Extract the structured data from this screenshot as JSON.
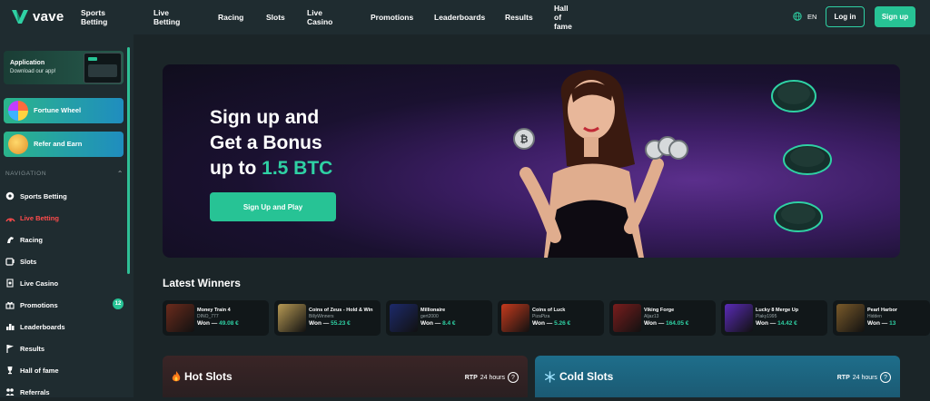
{
  "header": {
    "logo_text": "vave",
    "nav": [
      "Sports Betting",
      "Live Betting",
      "Racing",
      "Slots",
      "Live Casino",
      "Promotions",
      "Leaderboards",
      "Results",
      "Hall of fame"
    ],
    "lang": "EN",
    "login_label": "Log in",
    "signup_label": "Sign up",
    "accent": "#27c395"
  },
  "sidebar": {
    "app_card": {
      "title": "Application",
      "subtitle": "Download our app!"
    },
    "promos": [
      {
        "label": "Fortune Wheel",
        "icon": "fortune-wheel-icon"
      },
      {
        "label": "Refer and Earn",
        "icon": "coins-icon"
      }
    ],
    "nav_heading": "NAVIGATION",
    "items": [
      {
        "label": "Sports Betting",
        "icon": "soccer-ball-icon"
      },
      {
        "label": "Live Betting",
        "icon": "live-icon"
      },
      {
        "label": "Racing",
        "icon": "horse-icon"
      },
      {
        "label": "Slots",
        "icon": "slot-icon"
      },
      {
        "label": "Live Casino",
        "icon": "casino-chip-icon"
      },
      {
        "label": "Promotions",
        "icon": "gift-icon",
        "badge": "12"
      },
      {
        "label": "Leaderboards",
        "icon": "leaderboard-icon"
      },
      {
        "label": "Results",
        "icon": "flag-icon"
      },
      {
        "label": "Hall of fame",
        "icon": "trophy-icon"
      },
      {
        "label": "Referrals",
        "icon": "referrals-icon"
      }
    ]
  },
  "hero": {
    "line1": "Sign up and",
    "line2": "Get a Bonus",
    "line3_prefix": "up to ",
    "line3_highlight": "1.5 BTC",
    "cta": "Sign Up and Play"
  },
  "winners": {
    "title": "Latest Winners",
    "items": [
      {
        "game": "Money Train 4",
        "user": "DINO_777",
        "won_label": "Won —",
        "amount": "49.08 €",
        "color": "#6b2b1c"
      },
      {
        "game": "Coins of Zeus - Hold & Win",
        "user": "BillyWinners",
        "won_label": "Won —",
        "amount": "55.23 €",
        "color": "#b79a54"
      },
      {
        "game": "Millionaire",
        "user": "gert2000",
        "won_label": "Won —",
        "amount": "8.4 €",
        "color": "#1d2a6b"
      },
      {
        "game": "Coins of Luck",
        "user": "PizaPiza",
        "won_label": "Won —",
        "amount": "5.26 €",
        "color": "#c53a1d"
      },
      {
        "game": "Viking Forge",
        "user": "Aljaz13",
        "won_label": "Won —",
        "amount": "164.05 €",
        "color": "#7a1d1d"
      },
      {
        "game": "Lucky 8 Merge Up",
        "user": "Plaky1995",
        "won_label": "Won —",
        "amount": "14.42 €",
        "color": "#5a2bb8"
      },
      {
        "game": "Pearl Harbor",
        "user": "Hidden",
        "won_label": "Won —",
        "amount": "13",
        "color": "#7a5a2a"
      }
    ]
  },
  "hot_slots": {
    "title": "Hot Slots",
    "icon": "fire-icon",
    "rtp_label": "RTP",
    "rtp_period": "24 hours"
  },
  "cold_slots": {
    "title": "Cold Slots",
    "icon": "snowflake-icon",
    "rtp_label": "RTP",
    "rtp_period": "24 hours"
  }
}
